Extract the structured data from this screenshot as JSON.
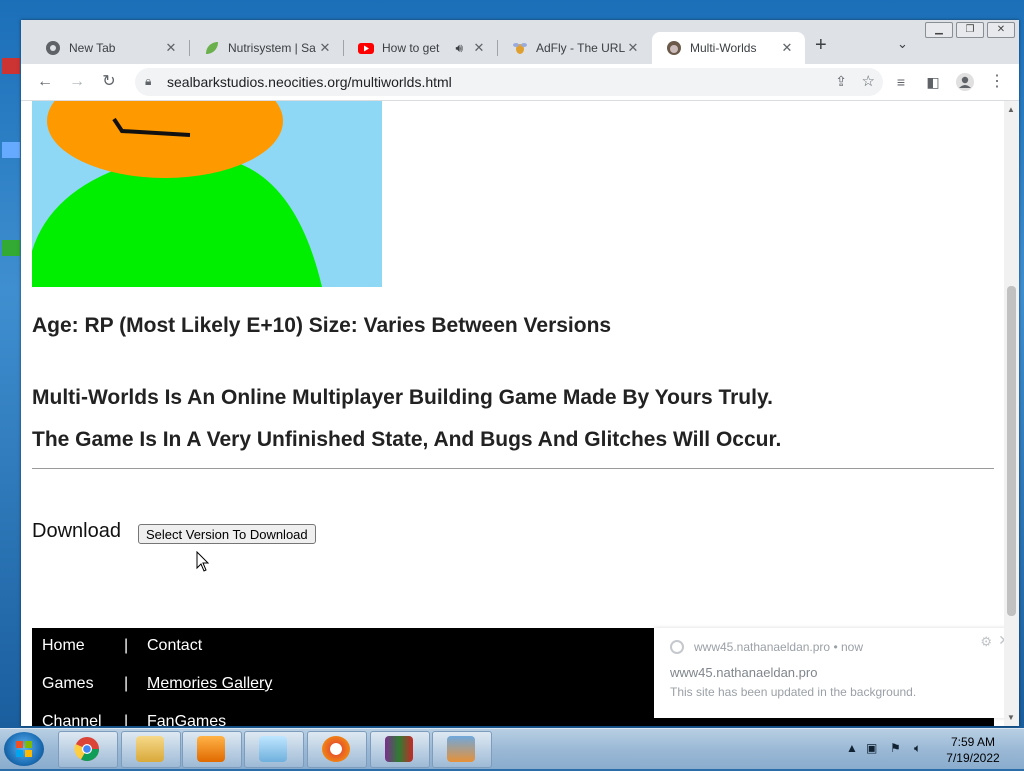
{
  "browser": {
    "tabs": [
      {
        "title": "New Tab",
        "favicon": "chrome-icon",
        "active": false
      },
      {
        "title": "Nutrisystem | Sa",
        "favicon": "leaf-icon",
        "active": false
      },
      {
        "title": "How to get",
        "favicon": "youtube-icon",
        "active": false,
        "audio": true
      },
      {
        "title": "AdFly - The URL",
        "favicon": "adfly-icon",
        "active": false
      },
      {
        "title": "Multi-Worlds",
        "favicon": "site-icon",
        "active": true
      }
    ],
    "new_tab_glyph": "+",
    "url": "sealbarkstudios.neocities.org/multiworlds.html"
  },
  "page": {
    "age_size": "Age: RP (Most Likely E+10) Size: Varies Between Versions",
    "desc1": "Multi-Worlds Is An Online Multiplayer Building Game Made By Yours Truly.",
    "desc2": "The Game Is In A Very Unfinished State, And Bugs And Glitches Will Occur.",
    "download_label": "Download",
    "download_button": "Select Version To Download",
    "footer": {
      "home": "Home",
      "contact": "Contact",
      "games": "Games",
      "memories": "Memories Gallery",
      "channel": "Channel",
      "fangames": "FanGames",
      "separator": "|"
    }
  },
  "notification": {
    "origin": "www45.nathanaeldan.pro",
    "time": "now",
    "site": "www45.nathanaeldan.pro",
    "message": "This site has been updated in the background."
  },
  "taskbar": {
    "time": "7:59 AM",
    "date": "7/19/2022"
  },
  "colors": {
    "sky": "#8fd8f5",
    "head": "#ff9900",
    "body": "#00ee00"
  }
}
